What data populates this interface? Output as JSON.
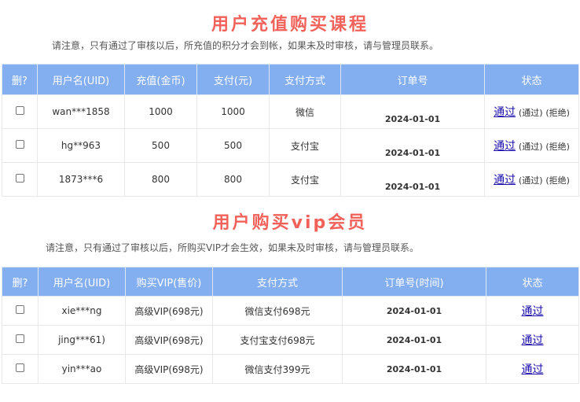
{
  "course": {
    "title": "用户充值购买课程",
    "notice": "请注意，只有通过了审核以后，所充值的积分才会到帐，如果未及时审核，请与管理员联系。",
    "headers": [
      "删?",
      "用户名(UID)",
      "充值(金币)",
      "支付(元)",
      "支付方式",
      "订单号",
      "状态"
    ],
    "rows": [
      {
        "user": "wan***1858",
        "gold": "1000",
        "paid": "1000",
        "method": "微信",
        "order": "2024-01-01",
        "approve": "通过",
        "approve_small": "(通过)",
        "reject": "(拒绝)"
      },
      {
        "user": "hg**963",
        "gold": "500",
        "paid": "500",
        "method": "支付宝",
        "order": "2024-01-01",
        "approve": "通过",
        "approve_small": "(通过)",
        "reject": "(拒绝)"
      },
      {
        "user": "1873***6",
        "gold": "800",
        "paid": "800",
        "method": "支付宝",
        "order": "2024-01-01",
        "approve": "通过",
        "approve_small": "(通过)",
        "reject": "(拒绝)"
      }
    ]
  },
  "vip": {
    "title": "用户购买vip会员",
    "notice": "请注意，只有通过了审核以后，所购买VIP才会生效，如果未及时审核，请与管理员联系。",
    "headers": [
      "删?",
      "用户名(UID)",
      "购买VIP(售价)",
      "支付方式",
      "订单号(时间)",
      "状态"
    ],
    "rows": [
      {
        "user": "xie***ng",
        "vip": "高级VIP(698元)",
        "method": "微信支付698元",
        "order": "2024-01-01",
        "approve": "通过"
      },
      {
        "user": "jing***61)",
        "vip": "高级VIP(698元)",
        "method": "支付宝支付698元",
        "order": "2024-01-01",
        "approve": "通过"
      },
      {
        "user": "yin***ao",
        "vip": "高级VIP(698元)",
        "method": "微信支付399元",
        "order": "2024-01-01",
        "approve": "通过"
      }
    ]
  },
  "colors": {
    "title": "#f2625a",
    "header_bg": "#83aef0",
    "link": "#1a0dab"
  }
}
